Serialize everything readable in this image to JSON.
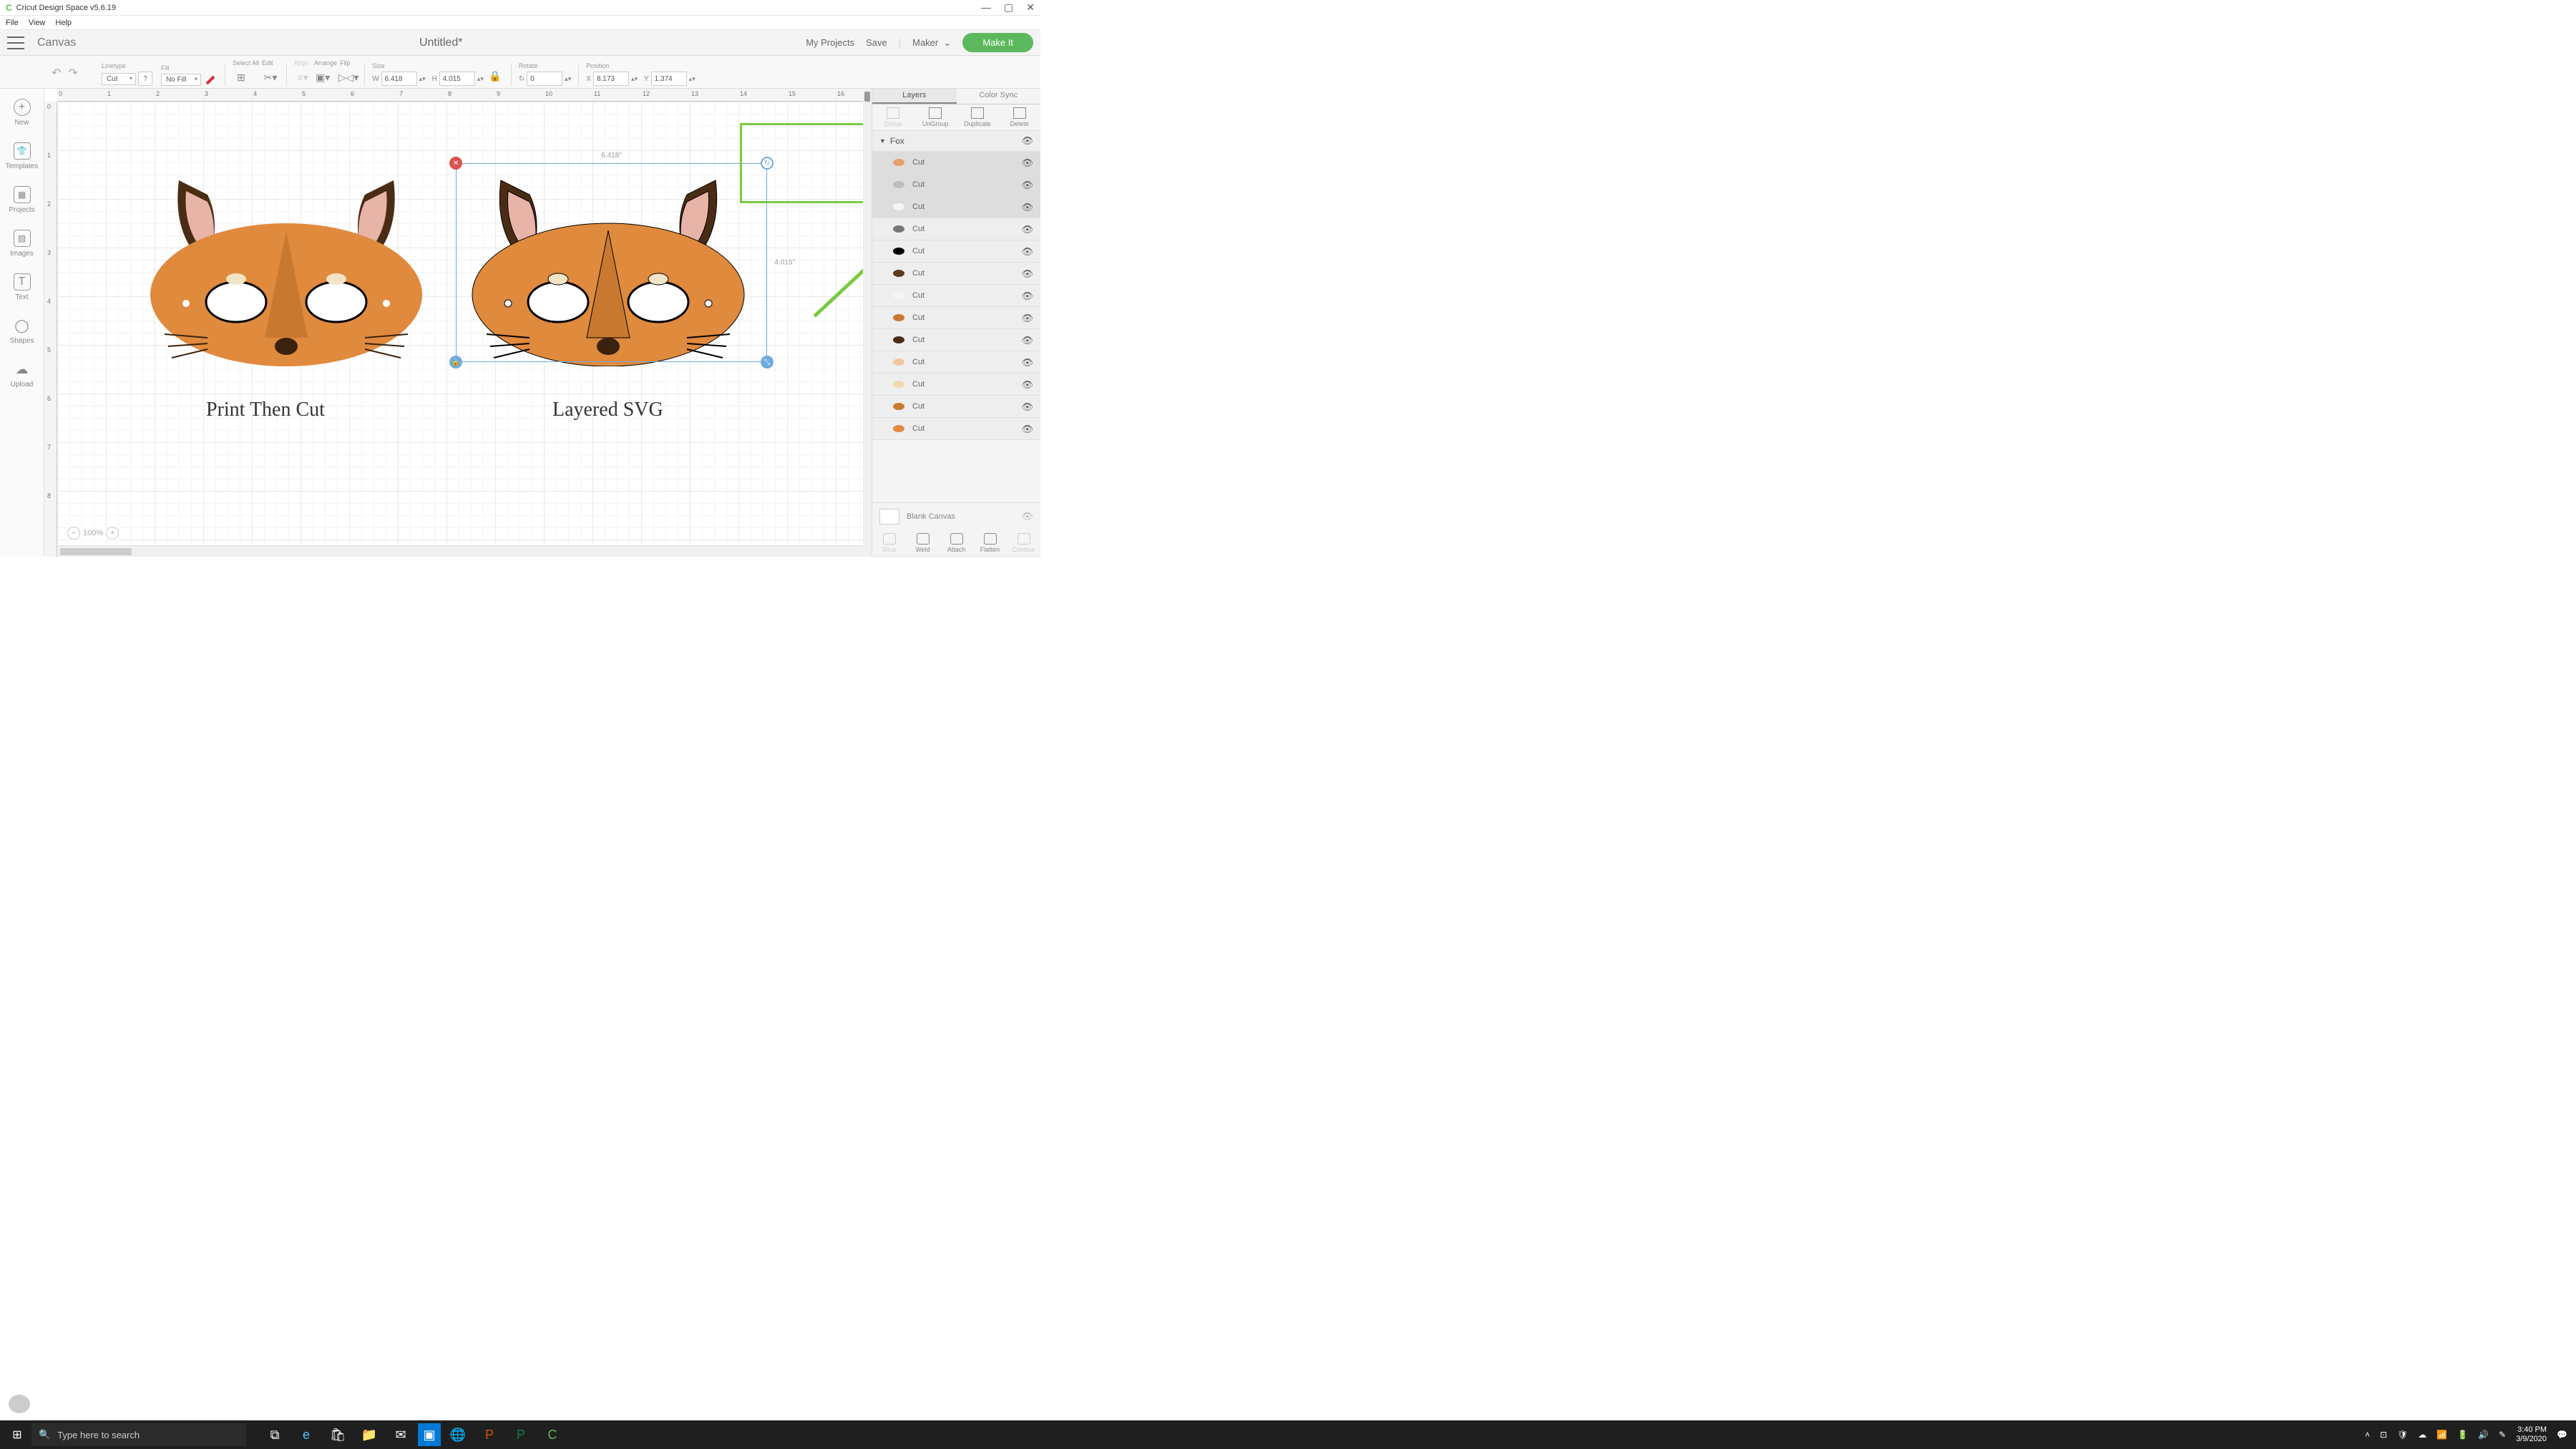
{
  "window": {
    "title": "Cricut Design Space  v5.6.19",
    "controls": {
      "min": "—",
      "max": "▢",
      "close": "✕"
    }
  },
  "menubar": [
    "File",
    "View",
    "Help"
  ],
  "header": {
    "canvas_label": "Canvas",
    "doc_title": "Untitled*",
    "my_projects": "My Projects",
    "save": "Save",
    "machine": "Maker",
    "make_it": "Make It"
  },
  "toolbar": {
    "linetype": {
      "label": "Linetype",
      "value": "Cut",
      "help": "?"
    },
    "fill": {
      "label": "Fill",
      "value": "No Fill"
    },
    "select_all": "Select All",
    "edit": "Edit",
    "align": "Align",
    "arrange": "Arrange",
    "flip": "Flip",
    "size": {
      "label": "Size",
      "w_label": "W",
      "w": "6.418",
      "h_label": "H",
      "h": "4.015"
    },
    "rotate": {
      "label": "Rotate",
      "value": "0"
    },
    "position": {
      "label": "Position",
      "x_label": "X",
      "x": "8.173",
      "y_label": "Y",
      "y": "1.374"
    }
  },
  "left_sidebar": [
    {
      "id": "new",
      "label": "New",
      "glyph": "+"
    },
    {
      "id": "templates",
      "label": "Templates",
      "glyph": "👕"
    },
    {
      "id": "projects",
      "label": "Projects",
      "glyph": "▦"
    },
    {
      "id": "images",
      "label": "Images",
      "glyph": "▧"
    },
    {
      "id": "text",
      "label": "Text",
      "glyph": "T"
    },
    {
      "id": "shapes",
      "label": "Shapes",
      "glyph": "◯"
    },
    {
      "id": "upload",
      "label": "Upload",
      "glyph": "☁"
    }
  ],
  "canvas": {
    "zoom": "100%",
    "ruler_h": [
      "0",
      "1",
      "2",
      "3",
      "4",
      "5",
      "6",
      "7",
      "8",
      "9",
      "10",
      "11",
      "12",
      "13",
      "14",
      "15",
      "16"
    ],
    "ruler_v": [
      "0",
      "1",
      "2",
      "3",
      "4",
      "5",
      "6",
      "7",
      "8"
    ],
    "labels": {
      "left": "Print Then Cut",
      "right": "Layered SVG"
    },
    "selection": {
      "w": "6.418\"",
      "h": "4.015\""
    }
  },
  "right_panel": {
    "tabs": {
      "layers": "Layers",
      "color_sync": "Color Sync"
    },
    "actions_top": [
      {
        "id": "group",
        "label": "Group",
        "disabled": true
      },
      {
        "id": "ungroup",
        "label": "UnGroup",
        "disabled": false
      },
      {
        "id": "duplicate",
        "label": "Duplicate",
        "disabled": false
      },
      {
        "id": "delete",
        "label": "Delete",
        "disabled": false
      }
    ],
    "group_name": "Fox",
    "layers": [
      {
        "label": "Cut",
        "color": "#e6a06c",
        "selected": true
      },
      {
        "label": "Cut",
        "color": "#bdbdbd",
        "selected": true
      },
      {
        "label": "Cut",
        "color": "#f5f5f5",
        "selected": true
      },
      {
        "label": "Cut",
        "color": "#777",
        "selected": false
      },
      {
        "label": "Cut",
        "color": "#000",
        "selected": false
      },
      {
        "label": "Cut",
        "color": "#5b3a1e",
        "selected": false
      },
      {
        "label": "Cut",
        "color": "#f5f5f0",
        "selected": false
      },
      {
        "label": "Cut",
        "color": "#c9792f",
        "selected": false
      },
      {
        "label": "Cut",
        "color": "#4a2c15",
        "selected": false
      },
      {
        "label": "Cut",
        "color": "#f0c9a0",
        "selected": false
      },
      {
        "label": "Cut",
        "color": "#f3d9b0",
        "selected": false
      },
      {
        "label": "Cut",
        "color": "#c9792f",
        "selected": false
      },
      {
        "label": "Cut",
        "color": "#e08a3e",
        "selected": false
      }
    ],
    "canvas_sel": "Blank Canvas",
    "actions_bottom": [
      {
        "id": "slice",
        "label": "Slice",
        "disabled": true
      },
      {
        "id": "weld",
        "label": "Weld",
        "disabled": false
      },
      {
        "id": "attach",
        "label": "Attach",
        "disabled": false
      },
      {
        "id": "flatten",
        "label": "Flatten",
        "disabled": false
      },
      {
        "id": "contour",
        "label": "Contour",
        "disabled": true
      }
    ]
  },
  "taskbar": {
    "search_placeholder": "Type here to search",
    "time": "3:40 PM",
    "date": "3/9/2020"
  }
}
